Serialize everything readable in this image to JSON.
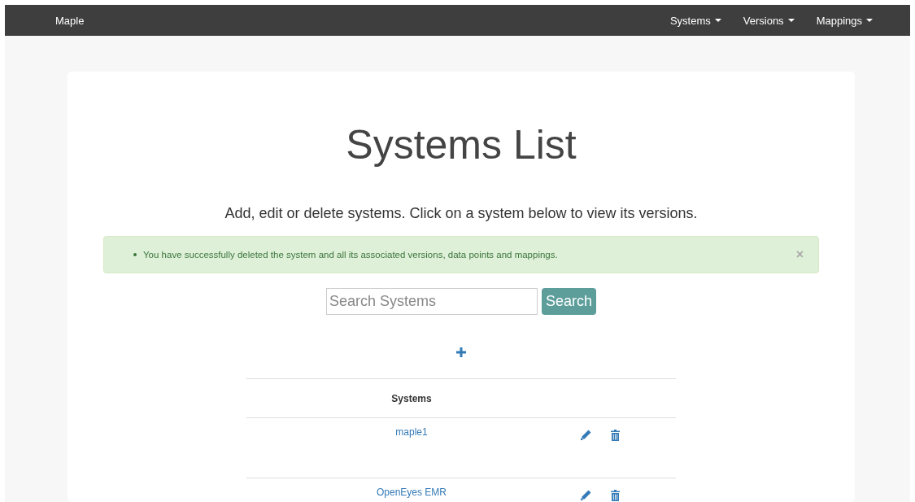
{
  "navbar": {
    "brand": "Maple",
    "menus": [
      {
        "label": "Systems"
      },
      {
        "label": "Versions"
      },
      {
        "label": "Mappings"
      }
    ]
  },
  "page": {
    "title": "Systems List",
    "subtitle": "Add, edit or delete systems. Click on a system below to view its versions."
  },
  "alert": {
    "messages": [
      "You have successfully deleted the system and all its associated versions, data points and mappings."
    ],
    "close": "×"
  },
  "search": {
    "placeholder": "Search Systems",
    "button": "Search"
  },
  "table": {
    "columns": [
      "Systems"
    ],
    "rows": [
      {
        "name": "maple1"
      },
      {
        "name": "OpenEyes EMR"
      }
    ]
  }
}
